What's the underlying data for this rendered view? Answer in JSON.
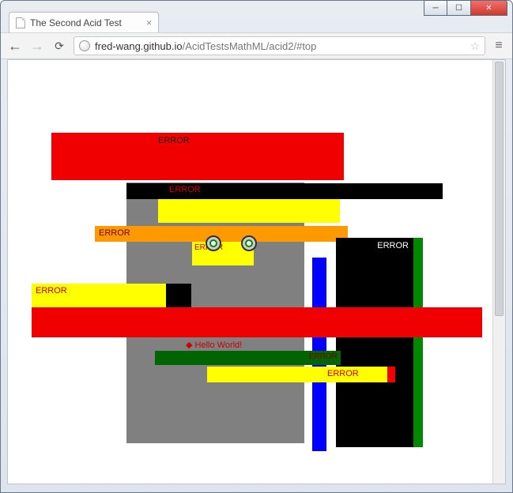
{
  "window": {
    "tab_title": "The Second Acid Test",
    "url_host": "fred-wang.github.io",
    "url_path": "/AcidTestsMathML/acid2/#top"
  },
  "labels": {
    "error": "ERROR",
    "hello": "Hello World!"
  },
  "colors": {
    "red": "#f00000",
    "yellow": "#ffff00",
    "black": "#000000",
    "gray": "#808080",
    "orange": "#ff9900",
    "green": "#008800",
    "darkgreen": "#006400",
    "blue": "#0000ff",
    "white": "#ffffff"
  }
}
